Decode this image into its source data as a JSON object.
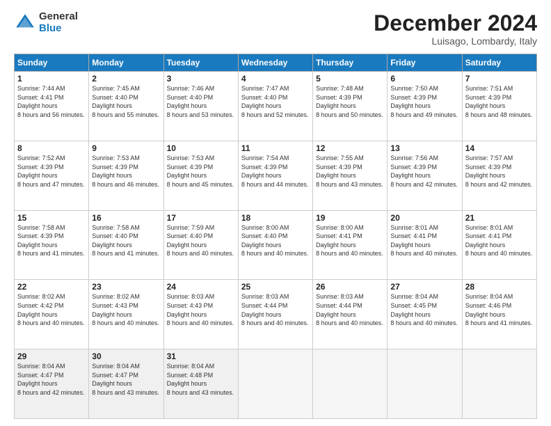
{
  "logo": {
    "general": "General",
    "blue": "Blue"
  },
  "header": {
    "title": "December 2024",
    "location": "Luisago, Lombardy, Italy"
  },
  "days_of_week": [
    "Sunday",
    "Monday",
    "Tuesday",
    "Wednesday",
    "Thursday",
    "Friday",
    "Saturday"
  ],
  "weeks": [
    [
      {
        "day": "1",
        "sunrise": "7:44 AM",
        "sunset": "4:41 PM",
        "daylight": "8 hours and 56 minutes."
      },
      {
        "day": "2",
        "sunrise": "7:45 AM",
        "sunset": "4:40 PM",
        "daylight": "8 hours and 55 minutes."
      },
      {
        "day": "3",
        "sunrise": "7:46 AM",
        "sunset": "4:40 PM",
        "daylight": "8 hours and 53 minutes."
      },
      {
        "day": "4",
        "sunrise": "7:47 AM",
        "sunset": "4:40 PM",
        "daylight": "8 hours and 52 minutes."
      },
      {
        "day": "5",
        "sunrise": "7:48 AM",
        "sunset": "4:39 PM",
        "daylight": "8 hours and 50 minutes."
      },
      {
        "day": "6",
        "sunrise": "7:50 AM",
        "sunset": "4:39 PM",
        "daylight": "8 hours and 49 minutes."
      },
      {
        "day": "7",
        "sunrise": "7:51 AM",
        "sunset": "4:39 PM",
        "daylight": "8 hours and 48 minutes."
      }
    ],
    [
      {
        "day": "8",
        "sunrise": "7:52 AM",
        "sunset": "4:39 PM",
        "daylight": "8 hours and 47 minutes."
      },
      {
        "day": "9",
        "sunrise": "7:53 AM",
        "sunset": "4:39 PM",
        "daylight": "8 hours and 46 minutes."
      },
      {
        "day": "10",
        "sunrise": "7:53 AM",
        "sunset": "4:39 PM",
        "daylight": "8 hours and 45 minutes."
      },
      {
        "day": "11",
        "sunrise": "7:54 AM",
        "sunset": "4:39 PM",
        "daylight": "8 hours and 44 minutes."
      },
      {
        "day": "12",
        "sunrise": "7:55 AM",
        "sunset": "4:39 PM",
        "daylight": "8 hours and 43 minutes."
      },
      {
        "day": "13",
        "sunrise": "7:56 AM",
        "sunset": "4:39 PM",
        "daylight": "8 hours and 42 minutes."
      },
      {
        "day": "14",
        "sunrise": "7:57 AM",
        "sunset": "4:39 PM",
        "daylight": "8 hours and 42 minutes."
      }
    ],
    [
      {
        "day": "15",
        "sunrise": "7:58 AM",
        "sunset": "4:39 PM",
        "daylight": "8 hours and 41 minutes."
      },
      {
        "day": "16",
        "sunrise": "7:58 AM",
        "sunset": "4:40 PM",
        "daylight": "8 hours and 41 minutes."
      },
      {
        "day": "17",
        "sunrise": "7:59 AM",
        "sunset": "4:40 PM",
        "daylight": "8 hours and 40 minutes."
      },
      {
        "day": "18",
        "sunrise": "8:00 AM",
        "sunset": "4:40 PM",
        "daylight": "8 hours and 40 minutes."
      },
      {
        "day": "19",
        "sunrise": "8:00 AM",
        "sunset": "4:41 PM",
        "daylight": "8 hours and 40 minutes."
      },
      {
        "day": "20",
        "sunrise": "8:01 AM",
        "sunset": "4:41 PM",
        "daylight": "8 hours and 40 minutes."
      },
      {
        "day": "21",
        "sunrise": "8:01 AM",
        "sunset": "4:41 PM",
        "daylight": "8 hours and 40 minutes."
      }
    ],
    [
      {
        "day": "22",
        "sunrise": "8:02 AM",
        "sunset": "4:42 PM",
        "daylight": "8 hours and 40 minutes."
      },
      {
        "day": "23",
        "sunrise": "8:02 AM",
        "sunset": "4:43 PM",
        "daylight": "8 hours and 40 minutes."
      },
      {
        "day": "24",
        "sunrise": "8:03 AM",
        "sunset": "4:43 PM",
        "daylight": "8 hours and 40 minutes."
      },
      {
        "day": "25",
        "sunrise": "8:03 AM",
        "sunset": "4:44 PM",
        "daylight": "8 hours and 40 minutes."
      },
      {
        "day": "26",
        "sunrise": "8:03 AM",
        "sunset": "4:44 PM",
        "daylight": "8 hours and 40 minutes."
      },
      {
        "day": "27",
        "sunrise": "8:04 AM",
        "sunset": "4:45 PM",
        "daylight": "8 hours and 40 minutes."
      },
      {
        "day": "28",
        "sunrise": "8:04 AM",
        "sunset": "4:46 PM",
        "daylight": "8 hours and 41 minutes."
      }
    ],
    [
      {
        "day": "29",
        "sunrise": "8:04 AM",
        "sunset": "4:47 PM",
        "daylight": "8 hours and 42 minutes."
      },
      {
        "day": "30",
        "sunrise": "8:04 AM",
        "sunset": "4:47 PM",
        "daylight": "8 hours and 43 minutes."
      },
      {
        "day": "31",
        "sunrise": "8:04 AM",
        "sunset": "4:48 PM",
        "daylight": "8 hours and 43 minutes."
      },
      null,
      null,
      null,
      null
    ]
  ]
}
